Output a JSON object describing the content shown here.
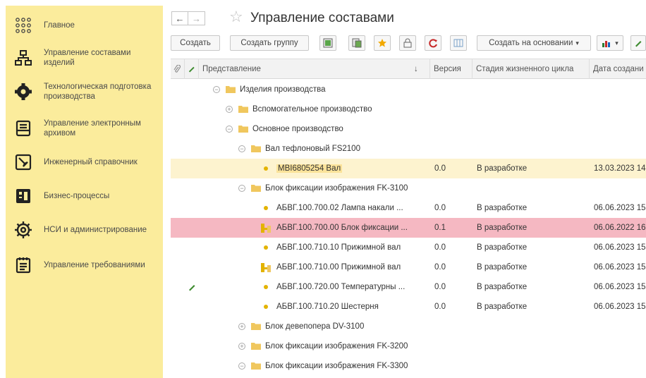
{
  "sidebar": {
    "items": [
      {
        "label": "Главное",
        "icon": "apps-grid-icon"
      },
      {
        "label": "Управление составами изделий",
        "icon": "hierarchy-icon"
      },
      {
        "label": "Технологическая подготовка производства",
        "icon": "gear-icon"
      },
      {
        "label": "Управление электронным архивом",
        "icon": "archive-icon"
      },
      {
        "label": "Инженерный справочник",
        "icon": "reference-book-icon"
      },
      {
        "label": "Бизнес-процессы",
        "icon": "business-process-icon"
      },
      {
        "label": "НСИ и администрирование",
        "icon": "settings-icon"
      },
      {
        "label": "Управление требованиями",
        "icon": "requirements-icon"
      }
    ]
  },
  "header": {
    "back": "←",
    "forward": "→",
    "favorite": "☆",
    "title": "Управление составами"
  },
  "toolbar": {
    "create": "Создать",
    "create_group": "Создать группу",
    "create_based_on": "Создать на основании",
    "dropdown_arrow": "▾"
  },
  "table": {
    "columns": {
      "representation": "Представление",
      "sort_arrow": "↓",
      "version": "Версия",
      "stage": "Стадия жизненного цикла",
      "created": "Дата создани"
    },
    "rows": [
      {
        "name": "Изделия производства",
        "kind": "folder",
        "toggle": "⊖",
        "version": "",
        "stage": "",
        "date": ""
      },
      {
        "name": "Вспомогательное производство",
        "kind": "folder",
        "toggle": "⊕",
        "version": "",
        "stage": "",
        "date": ""
      },
      {
        "name": "Основное производство",
        "kind": "folder",
        "toggle": "⊖",
        "version": "",
        "stage": "",
        "date": ""
      },
      {
        "name": "Вал тефлоновый FS2100",
        "kind": "folder",
        "toggle": "⊖",
        "version": "",
        "stage": "",
        "date": ""
      },
      {
        "name": "MBI6805254 Вал",
        "kind": "item",
        "toggle": "",
        "version": "0.0",
        "stage": "В разработке",
        "date": "13.03.2023 14"
      },
      {
        "name": "Блок фиксации изображения FK-3100",
        "kind": "folder",
        "toggle": "⊖",
        "version": "",
        "stage": "",
        "date": ""
      },
      {
        "name": "АБВГ.100.700.02 Лампа накали ...",
        "kind": "item",
        "toggle": "",
        "version": "0.0",
        "stage": "В разработке",
        "date": "06.06.2023 15"
      },
      {
        "name": "АБВГ.100.700.00 Блок фиксации ...",
        "kind": "assembly",
        "toggle": "",
        "version": "0.1",
        "stage": "В разработке",
        "date": "06.06.2022 16"
      },
      {
        "name": "АБВГ.100.710.10 Прижимной вал",
        "kind": "item",
        "toggle": "",
        "version": "0.0",
        "stage": "В разработке",
        "date": "06.06.2023 15"
      },
      {
        "name": "АБВГ.100.710.00 Прижимной вал",
        "kind": "assembly",
        "toggle": "",
        "version": "0.0",
        "stage": "В разработке",
        "date": "06.06.2023 15"
      },
      {
        "name": "АБВГ.100.720.00 Температурны ...",
        "kind": "item",
        "toggle": "",
        "version": "0.0",
        "stage": "В разработке",
        "date": "06.06.2023 15",
        "edited": true
      },
      {
        "name": "АБВГ.100.710.20 Шестерня",
        "kind": "item",
        "toggle": "",
        "version": "0.0",
        "stage": "В разработке",
        "date": "06.06.2023 15"
      },
      {
        "name": "Блок девепопера DV-3100",
        "kind": "folder",
        "toggle": "⊕",
        "version": "",
        "stage": "",
        "date": ""
      },
      {
        "name": "Блок фиксации изображения FK-3200",
        "kind": "folder",
        "toggle": "⊕",
        "version": "",
        "stage": "",
        "date": ""
      },
      {
        "name": "Блок фиксации изображения FK-3300",
        "kind": "folder",
        "toggle": "⊖",
        "version": "",
        "stage": "",
        "date": ""
      }
    ]
  },
  "colors": {
    "sidebar_bg": "#fbec9c",
    "selected_row": "#fdf3cf",
    "current_row": "#f5b8c2",
    "folder": "#f0c75e",
    "item_dot": "#e3b300"
  }
}
